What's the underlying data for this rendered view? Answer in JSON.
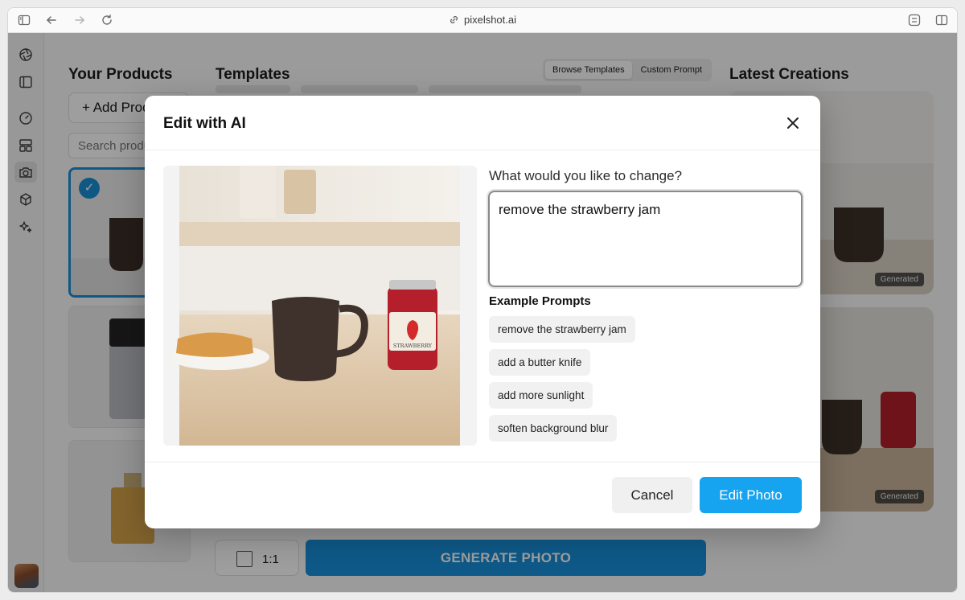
{
  "browser": {
    "url": "pixelshot.ai"
  },
  "products": {
    "title": "Your Products",
    "add_label": "+ Add Product",
    "search_placeholder": "Search products"
  },
  "templates": {
    "title": "Templates",
    "tabs": [
      "Browse Templates",
      "Custom Prompt"
    ],
    "active_tab": "Browse Templates"
  },
  "generator": {
    "ratio": "1:1",
    "generate_label": "GENERATE PHOTO"
  },
  "latest": {
    "title": "Latest Creations",
    "items": [
      {
        "badge": "Generated"
      },
      {
        "badge": "Generated"
      }
    ]
  },
  "modal": {
    "title": "Edit with AI",
    "question": "What would you like to change?",
    "prompt_value": "remove the strawberry jam",
    "examples_title": "Example Prompts",
    "examples": [
      "remove the strawberry jam",
      "add a butter knife",
      "add more sunlight",
      "soften background blur"
    ],
    "cancel_label": "Cancel",
    "edit_label": "Edit Photo",
    "jar_label": "STRAWBERRY"
  },
  "colors": {
    "accent": "#16a3ef",
    "generate": "#1890dc",
    "selected_border": "#1a8fd6"
  }
}
